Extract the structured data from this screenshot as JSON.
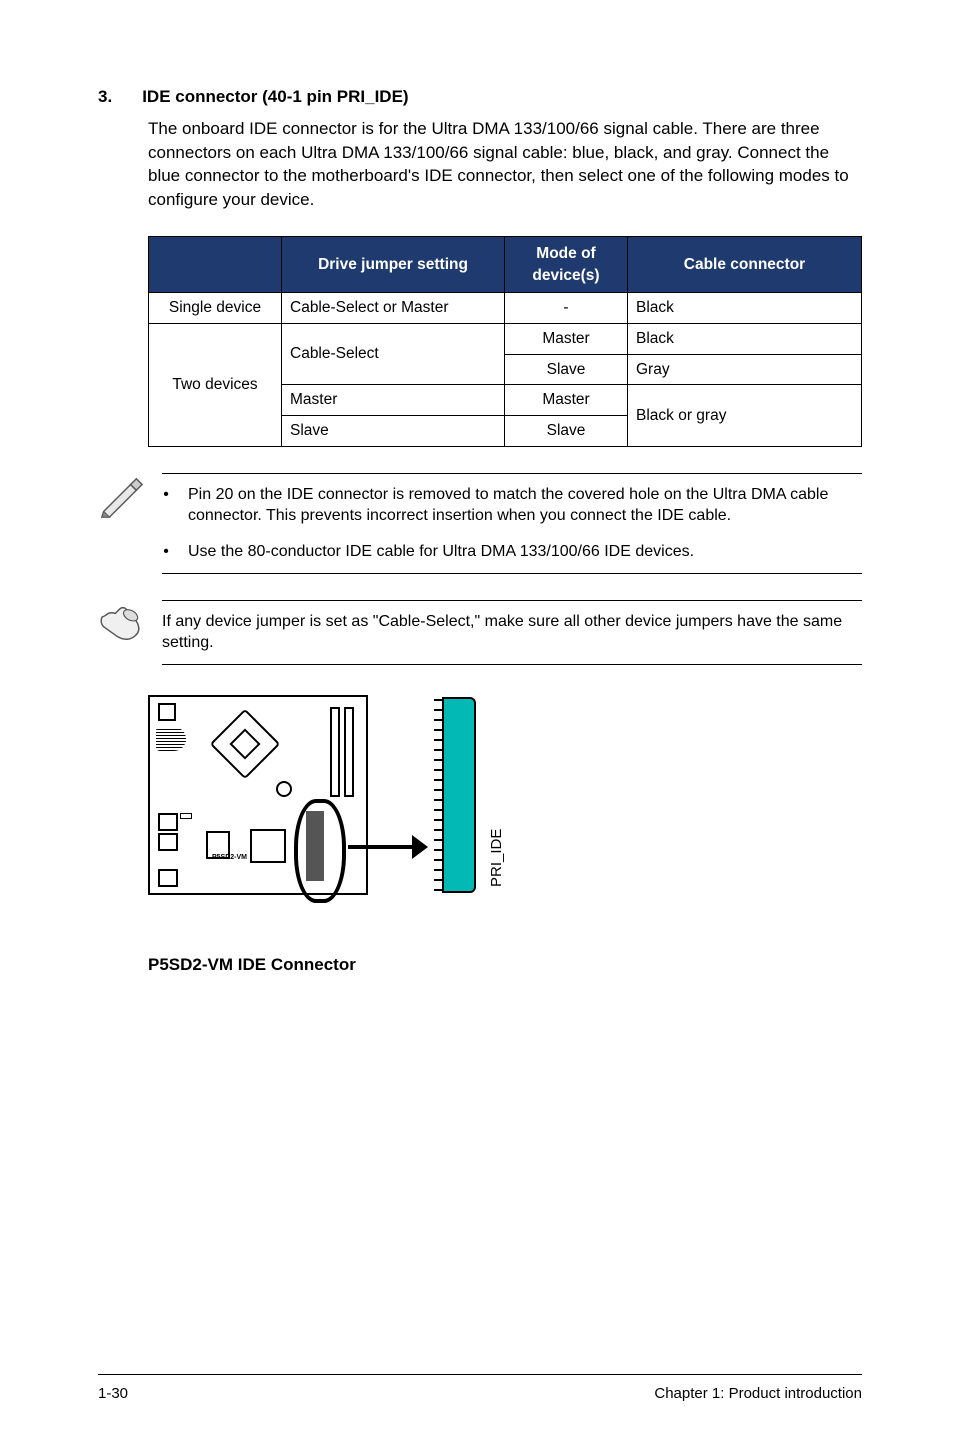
{
  "heading": {
    "num": "3.",
    "text": "IDE connector (40-1 pin PRI_IDE)"
  },
  "description": "The onboard IDE connector is for the Ultra DMA 133/100/66 signal cable. There are three connectors on each Ultra DMA 133/100/66 signal cable: blue, black, and gray. Connect the blue connector to the motherboard's IDE connector, then select one of the following modes to configure your device.",
  "table": {
    "headers": {
      "c1": "",
      "c2": "Drive jumper setting",
      "c3": "Mode of device(s)",
      "c4": "Cable connector"
    },
    "r1": {
      "c1": "Single device",
      "c2": "Cable-Select or Master",
      "c3": "-",
      "c4": "Black"
    },
    "r2": {
      "c1": "Two devices",
      "c2": "Cable-Select",
      "c3": "Master",
      "c4": "Black"
    },
    "r3": {
      "c3": "Slave",
      "c4": "Gray"
    },
    "r4": {
      "c2": "Master",
      "c3": "Master",
      "c4": "Black or gray"
    },
    "r5": {
      "c2": "Slave",
      "c3": "Slave"
    }
  },
  "note1": {
    "b1": "Pin 20 on the IDE connector is removed to match the covered hole on the Ultra DMA cable connector. This prevents incorrect insertion when you connect the IDE cable.",
    "b2_pre": "Use the 80-conductor IDE cable for Ultra DMA ",
    "b2_bold": "133/100/66",
    "b2_post": " IDE devices."
  },
  "note2": "If any device jumper is set as \"Cable-Select,\" make sure all other device jumpers have the same setting.",
  "diagram": {
    "brand": "P5SD2-VM",
    "pri": "PRI_IDE",
    "caption_bold": "P5SD2-VM",
    "caption_rest": " IDE Connector"
  },
  "footer": {
    "left": "1-30",
    "right": "Chapter 1: Product introduction"
  }
}
